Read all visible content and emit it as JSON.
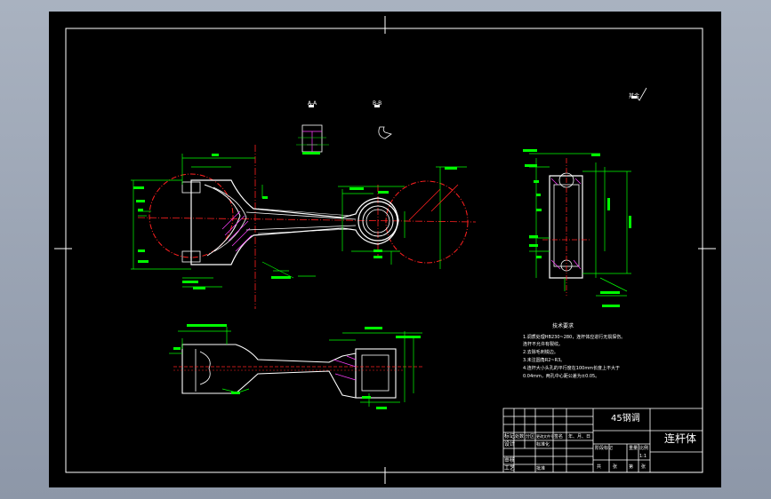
{
  "colors": {
    "background": "#000000",
    "outline": "#ffffff",
    "dimension": "#00ff00",
    "centerline": "#ff2020",
    "hatch": "#ff40ff",
    "viewport_top": "#a9b2c0",
    "viewport_bottom": "#8d97a8"
  },
  "title_block": {
    "part_name": "连杆体",
    "material": "45钢调",
    "row_labels": [
      "标记",
      "设计",
      "审核",
      "工艺"
    ],
    "header_cells": [
      "处数",
      "分区",
      "更改文件号",
      "签名",
      "年、月、日"
    ],
    "std_label": "标准化",
    "approve_label": "批准",
    "stage_row": [
      "阶段标记",
      "重量",
      "比例"
    ],
    "scale_value": "1:1",
    "sheet_row": [
      "共",
      "张",
      "第",
      "张"
    ]
  },
  "notes": {
    "heading": "技术要求",
    "lines": [
      "1.调质处理HB230~280，连杆体应进行无损探伤。",
      "  连杆不允许有裂纹。",
      "2.去除毛刺锐边。",
      "3.未注圆角R2~R3。",
      "4.连杆大小头孔的平行度在100mm长度上不大于",
      "  0.04mm，两孔中心距公差为±0.05。"
    ]
  },
  "view_labels": {
    "section_a": "A-A",
    "section_b": "B-B",
    "roughness_mark": "其余"
  }
}
